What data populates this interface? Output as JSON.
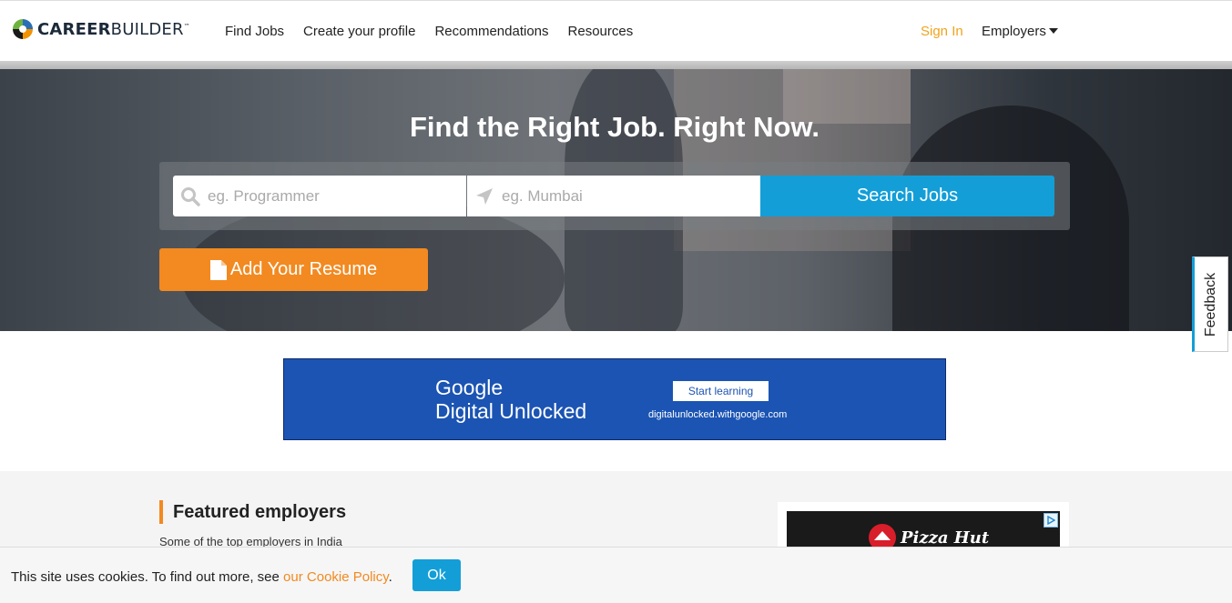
{
  "header": {
    "logo": {
      "bold": "CAREER",
      "light": "BUILDER",
      "mark": "™"
    },
    "nav": [
      "Find Jobs",
      "Create your profile",
      "Recommendations",
      "Resources"
    ],
    "signin": "Sign In",
    "employers": "Employers"
  },
  "hero": {
    "title": "Find the Right Job. Right Now.",
    "keyword_placeholder": "eg. Programmer",
    "location_placeholder": "eg. Mumbai",
    "search_label": "Search Jobs",
    "resume_label": "Add Your Resume"
  },
  "feedback": "Feedback",
  "ad": {
    "brand_line1": "Google",
    "brand_line2": "Digital Unlocked",
    "cta": "Start learning",
    "url": "digitalunlocked.withgoogle.com"
  },
  "featured": {
    "heading": "Featured employers",
    "subtext": "Some of the top employers in India",
    "side_ad_brand": "Pizza Hut"
  },
  "cookie": {
    "text": "This site uses cookies. To find out more, see ",
    "link": "our Cookie Policy",
    "suffix": ".",
    "ok": "Ok"
  },
  "colors": {
    "accent_blue": "#139ed8",
    "accent_orange": "#f28a21",
    "signin": "#f0a31c",
    "ad_blue": "#1b54b3"
  },
  "icons": [
    "search-icon",
    "location-arrow-icon",
    "file-icon",
    "caret-down-icon",
    "adchoices-icon"
  ]
}
